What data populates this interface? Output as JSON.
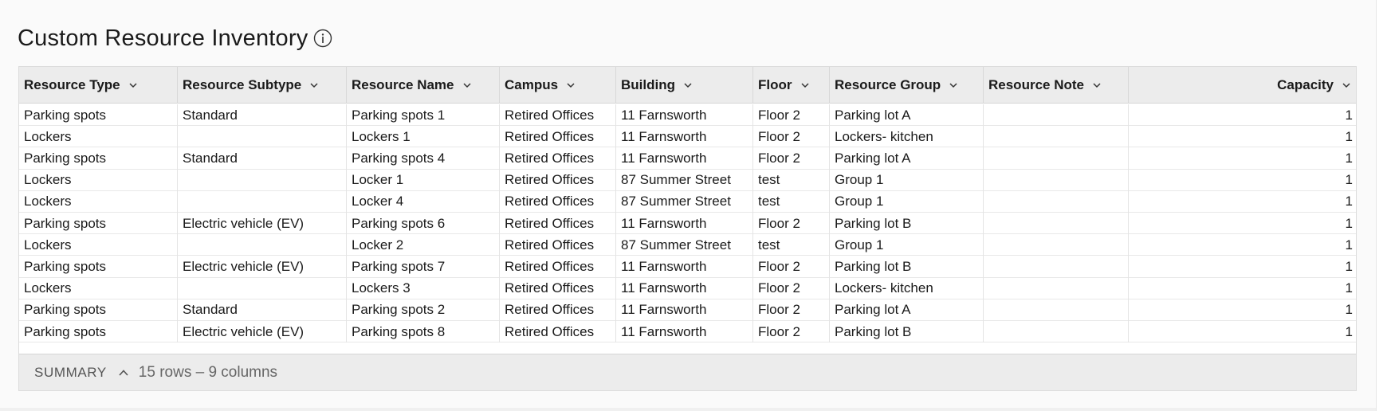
{
  "page": {
    "title": "Custom Resource Inventory"
  },
  "icons": {
    "info": "info-icon",
    "sort": "chevron-down-icon",
    "summary_toggle": "chevron-up-icon"
  },
  "colors": {
    "header_bg": "#ececec",
    "row_border": "#e8e8e8",
    "text": "#1a1a1a"
  },
  "table": {
    "columns": [
      "Resource Type",
      "Resource Subtype",
      "Resource Name",
      "Campus",
      "Building",
      "Floor",
      "Resource Group",
      "Resource Note",
      "Capacity"
    ],
    "rows": [
      [
        "Parking spots",
        "Standard",
        "Parking spots 1",
        "Retired Offices",
        "11 Farnsworth",
        "Floor 2",
        "Parking lot A",
        "",
        "1"
      ],
      [
        "Lockers",
        "",
        "Lockers 1",
        "Retired Offices",
        "11 Farnsworth",
        "Floor 2",
        "Lockers- kitchen",
        "",
        "1"
      ],
      [
        "Parking spots",
        "Standard",
        "Parking spots 4",
        "Retired Offices",
        "11 Farnsworth",
        "Floor 2",
        "Parking lot A",
        "",
        "1"
      ],
      [
        "Lockers",
        "",
        "Locker 1",
        "Retired Offices",
        "87 Summer Street",
        "test",
        "Group 1",
        "",
        "1"
      ],
      [
        "Lockers",
        "",
        "Locker 4",
        "Retired Offices",
        "87 Summer Street",
        "test",
        "Group 1",
        "",
        "1"
      ],
      [
        "Parking spots",
        "Electric vehicle (EV)",
        "Parking spots 6",
        "Retired Offices",
        "11 Farnsworth",
        "Floor 2",
        "Parking lot B",
        "",
        "1"
      ],
      [
        "Lockers",
        "",
        "Locker 2",
        "Retired Offices",
        "87 Summer Street",
        "test",
        "Group 1",
        "",
        "1"
      ],
      [
        "Parking spots",
        "Electric vehicle (EV)",
        "Parking spots 7",
        "Retired Offices",
        "11 Farnsworth",
        "Floor 2",
        "Parking lot B",
        "",
        "1"
      ],
      [
        "Lockers",
        "",
        "Lockers 3",
        "Retired Offices",
        "11 Farnsworth",
        "Floor 2",
        "Lockers- kitchen",
        "",
        "1"
      ],
      [
        "Parking spots",
        "Standard",
        "Parking spots 2",
        "Retired Offices",
        "11 Farnsworth",
        "Floor 2",
        "Parking lot A",
        "",
        "1"
      ],
      [
        "Parking spots",
        "Electric vehicle (EV)",
        "Parking spots 8",
        "Retired Offices",
        "11 Farnsworth",
        "Floor 2",
        "Parking lot B",
        "",
        "1"
      ]
    ]
  },
  "summary": {
    "label": "SUMMARY",
    "count": "15 rows – 9 columns"
  }
}
